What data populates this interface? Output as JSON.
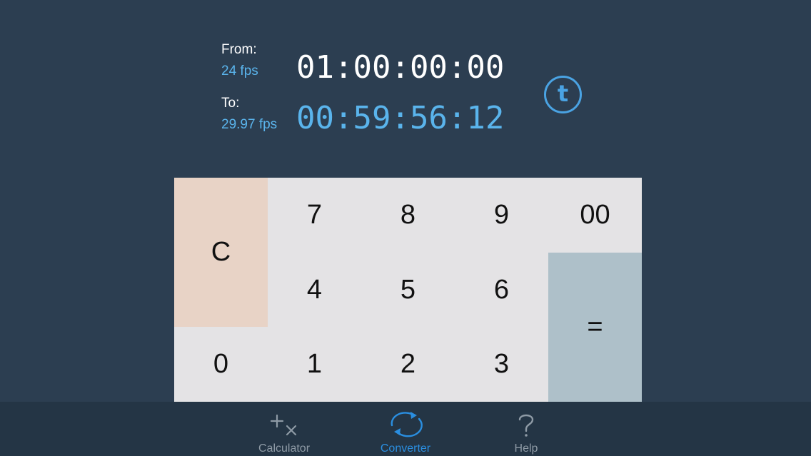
{
  "converter": {
    "from_label": "From:",
    "from_fps": "24 fps",
    "from_timecode": "01:00:00:00",
    "to_label": "To:",
    "to_fps": "29.97 fps",
    "to_timecode": "00:59:56:12",
    "mode_button": "t"
  },
  "keypad": {
    "clear": "C",
    "k7": "7",
    "k8": "8",
    "k9": "9",
    "k00": "00",
    "k4": "4",
    "k5": "5",
    "k6": "6",
    "k0": "0",
    "k1": "1",
    "k2": "2",
    "k3": "3",
    "equals": "="
  },
  "tabbar": {
    "tabs": [
      {
        "label": "Calculator",
        "icon": "plus-times-icon",
        "active": false
      },
      {
        "label": "Converter",
        "icon": "convert-cycle-icon",
        "active": true
      },
      {
        "label": "Help",
        "icon": "question-icon",
        "active": false
      }
    ]
  },
  "colors": {
    "background": "#2c3e51",
    "accent": "#5ab4ec",
    "clear_key": "#e8d3c6",
    "equals_key": "#aec0c9",
    "keypad": "#e4e3e5",
    "tabbar": "#243545",
    "active_tab": "#2a8ee0"
  }
}
